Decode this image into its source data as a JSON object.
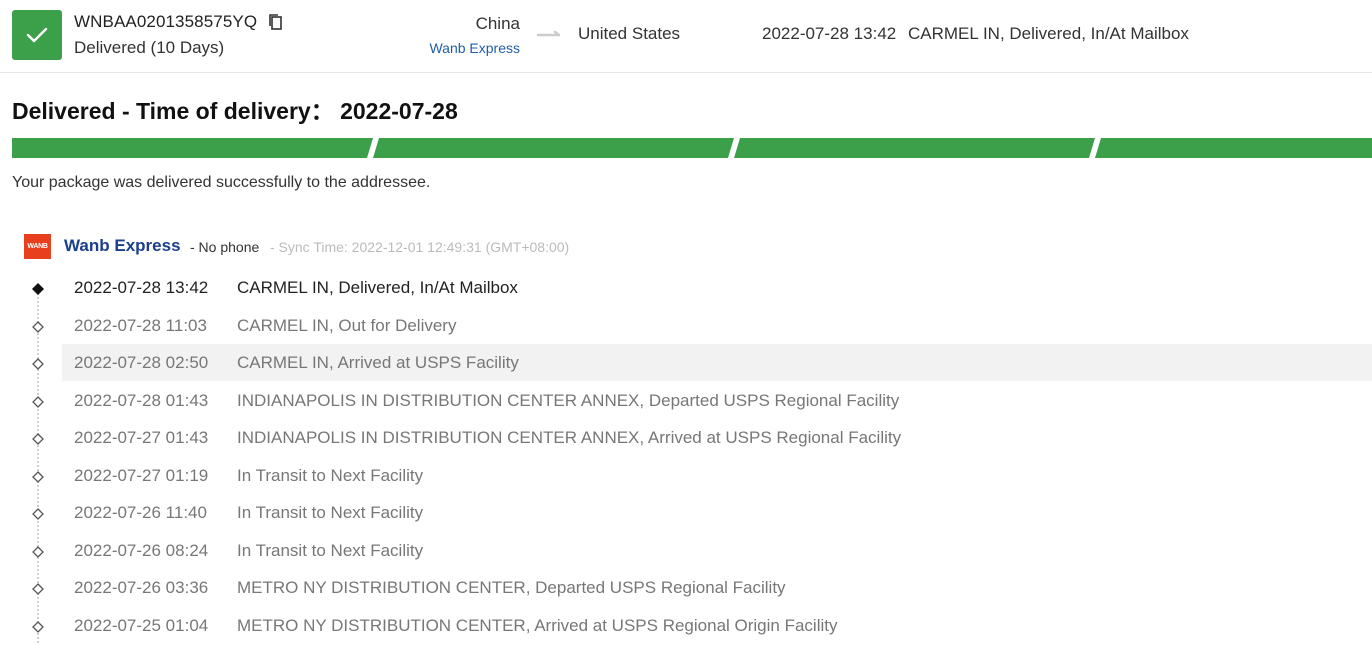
{
  "header": {
    "tracking_number": "WNBAA0201358575YQ",
    "status_summary": "Delivered (10 Days)",
    "origin": "China",
    "carrier": "Wanb Express",
    "destination": "United States",
    "latest_time": "2022-07-28 13:42",
    "latest_event": "CARMEL IN, Delivered, In/At Mailbox"
  },
  "delivery": {
    "title": "Delivered - Time of delivery：  2022-07-28",
    "message": "Your package was delivered successfully to the addressee.",
    "progress_segments_complete": 4,
    "progress_segments_total": 4
  },
  "carrier_info": {
    "logo_text": "WANB",
    "name": "Wanb Express",
    "phone": "- No phone",
    "sync": "- Sync Time: 2022-12-01 12:49:31 (GMT+08:00)"
  },
  "events": [
    {
      "time": "2022-07-28 13:42",
      "desc": "CARMEL IN, Delivered, In/At Mailbox"
    },
    {
      "time": "2022-07-28 11:03",
      "desc": "CARMEL IN, Out for Delivery"
    },
    {
      "time": "2022-07-28 02:50",
      "desc": "CARMEL IN, Arrived at USPS Facility"
    },
    {
      "time": "2022-07-28 01:43",
      "desc": "INDIANAPOLIS IN DISTRIBUTION CENTER ANNEX, Departed USPS Regional Facility"
    },
    {
      "time": "2022-07-27 01:43",
      "desc": "INDIANAPOLIS IN DISTRIBUTION CENTER ANNEX, Arrived at USPS Regional Facility"
    },
    {
      "time": "2022-07-27 01:19",
      "desc": "In Transit to Next Facility"
    },
    {
      "time": "2022-07-26 11:40",
      "desc": "In Transit to Next Facility"
    },
    {
      "time": "2022-07-26 08:24",
      "desc": "In Transit to Next Facility"
    },
    {
      "time": "2022-07-26 03:36",
      "desc": "METRO NY DISTRIBUTION CENTER, Departed USPS Regional Facility"
    },
    {
      "time": "2022-07-25 01:04",
      "desc": "METRO NY DISTRIBUTION CENTER, Arrived at USPS Regional Origin Facility"
    }
  ],
  "colors": {
    "success_green": "#3ba049",
    "carrier_blue": "#1a3f8c",
    "link_blue": "#1f5fa8",
    "logo_red": "#e8401f"
  },
  "icons": {
    "status": "checkmark-icon",
    "copy": "copy-icon",
    "route": "arrow-right-icon",
    "latest_node": "filled-diamond-icon",
    "node": "hollow-diamond-icon"
  }
}
